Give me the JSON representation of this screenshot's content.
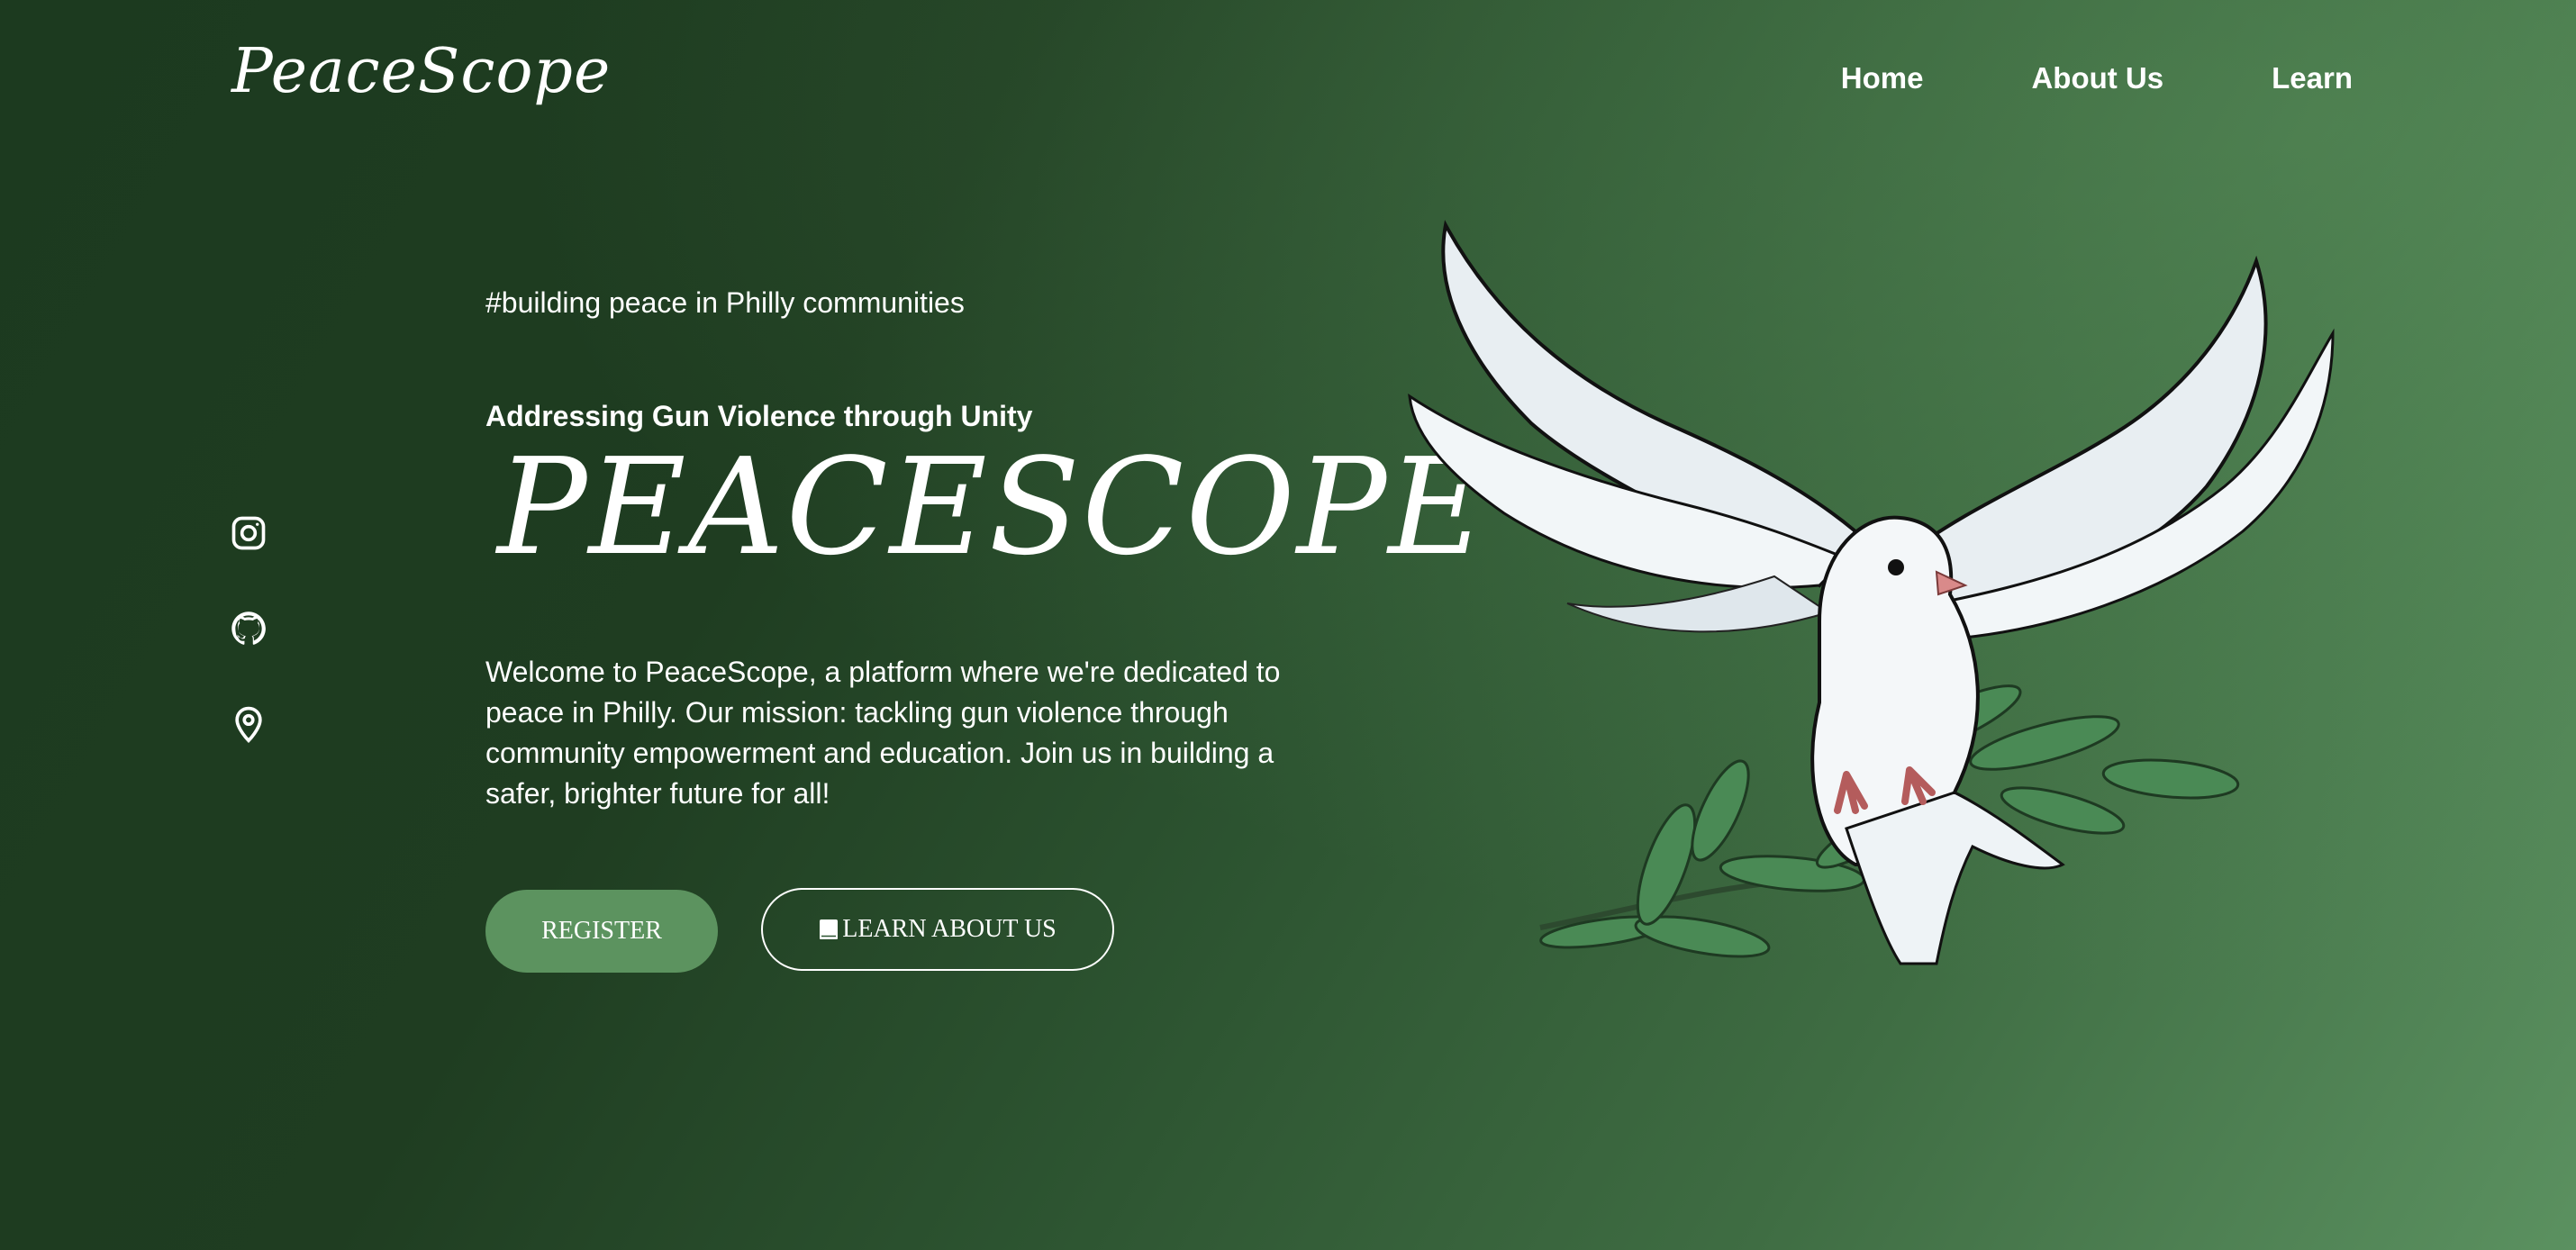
{
  "header": {
    "logo": "PeaceScope",
    "nav": [
      {
        "label": "Home"
      },
      {
        "label": "About Us"
      },
      {
        "label": "Learn"
      }
    ]
  },
  "socials": [
    {
      "icon": "instagram-icon"
    },
    {
      "icon": "github-icon"
    },
    {
      "icon": "map-pin-icon"
    }
  ],
  "hero": {
    "hashtag": "#building peace in Philly communities",
    "subtitle": "Addressing Gun Violence through Unity",
    "title": "PEACESCOPE",
    "description": "Welcome to PeaceScope, a platform where we're dedicated to peace in Philly. Our mission: tackling gun violence through community empowerment and education. Join us in building a safer, brighter future for all!",
    "register_label": "REGISTER",
    "learn_label": "LEARN ABOUT US",
    "learn_icon": "book-icon"
  },
  "colors": {
    "bg_dark": "#1c3a1f",
    "bg_light": "#5b9160",
    "button_green": "#5c935f"
  }
}
